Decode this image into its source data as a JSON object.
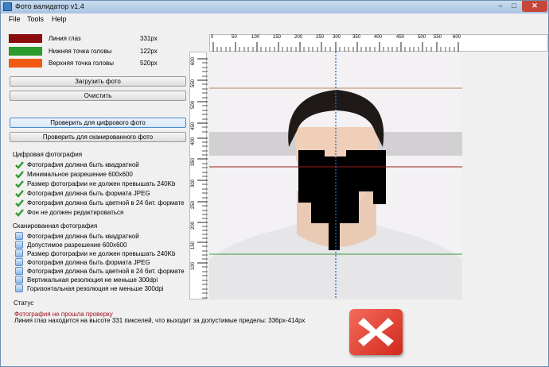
{
  "window": {
    "title": "Фото валидатор v1.4",
    "minimize_glyph": "–",
    "maximize_glyph": "□",
    "close_glyph": "✕"
  },
  "menu": [
    "File",
    "Tools",
    "Help"
  ],
  "legend": [
    {
      "label": "Линия глаз",
      "value": "331px",
      "color": "#8b0d0d"
    },
    {
      "label": "Нижняя точка головы",
      "value": "122px",
      "color": "#2c9a2c"
    },
    {
      "label": "Верхняя точка головы",
      "value": "520px",
      "color": "#f05a13"
    }
  ],
  "buttons": {
    "load": "Загрузить фото",
    "clear": "Очистить",
    "check_digital": "Проверить для цифрового фото",
    "check_scanned": "Проверить для сканированного фото"
  },
  "digital": {
    "title": "Цифровая фотография",
    "items": [
      "Фотография должна быть квадратной",
      "Минимальное разрешение 600x600",
      "Размер фотографии не должен превышать 240Kb",
      "Фотография должна быть формата JPEG",
      "Фотография должна быть цветной в 24 бит. формате",
      "Фон не должен редактироваться"
    ]
  },
  "scanned": {
    "title": "Сканированная фотография",
    "items": [
      "Фотография должна быть квадратной",
      "Допустимое разрешение 600x600",
      "Размер фотографии не должен превышать 240Kb",
      "Фотография должна быть формата JPEG",
      "Фотография должна быть цветной в 24 бит. формате",
      "Вертикальная резолюция не меньше 300dpi",
      "Горизонтальная резолюция не меньше 300dpi"
    ]
  },
  "ruler": {
    "top_labels": [
      "0",
      "50",
      "100",
      "150",
      "200",
      "250",
      "300",
      "350",
      "400",
      "450",
      "500",
      "550",
      "600"
    ],
    "left_labels": [
      "600",
      "550",
      "500",
      "450",
      "400",
      "350",
      "300",
      "250",
      "200",
      "150",
      "100"
    ]
  },
  "status": {
    "title": "Статус",
    "error": "Фотография не прошла проверку",
    "detail": "Линия глаз находится на высоте 331 пикселей, что выходит за допустимые пределы: 336px-414px"
  },
  "colors": {
    "error": "#a0121e",
    "center_line": "#2a6fb8",
    "fail_icon": "#e0392b"
  }
}
